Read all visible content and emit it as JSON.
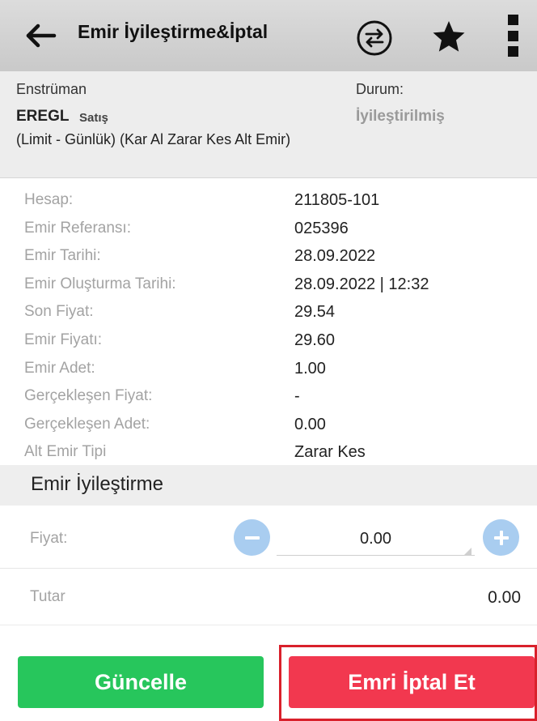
{
  "header": {
    "title": "Emir İyileştirme&İptal",
    "back_icon": "arrow-left-icon",
    "swap_icon": "swap-circle-icon",
    "favorite_icon": "star-icon",
    "more_icon": "more-vertical-icon"
  },
  "summary": {
    "instrument_label": "Enstrüman",
    "instrument_code": "EREGL",
    "side": "Satış",
    "description": "(Limit - Günlük)  (Kar Al Zarar Kes Alt Emir)",
    "status_label": "Durum:",
    "status_value": "İyileştirilmiş"
  },
  "details": [
    {
      "key": "Hesap:",
      "value": "211805-101"
    },
    {
      "key": "Emir Referansı:",
      "value": "025396"
    },
    {
      "key": "Emir Tarihi:",
      "value": "28.09.2022"
    },
    {
      "key": "Emir Oluşturma Tarihi:",
      "value": "28.09.2022 | 12:32"
    },
    {
      "key": "Son Fiyat:",
      "value": "29.54"
    },
    {
      "key": "Emir Fiyatı:",
      "value": "29.60"
    },
    {
      "key": "Emir Adet:",
      "value": "1.00"
    },
    {
      "key": "Gerçekleşen Fiyat:",
      "value": "-"
    },
    {
      "key": "Gerçekleşen Adet:",
      "value": "0.00"
    },
    {
      "key": "Alt Emir Tipi",
      "value": "Zarar Kes"
    }
  ],
  "improve": {
    "section_title": "Emir İyileştirme",
    "price_label": "Fiyat:",
    "price_value": "0.00",
    "total_label": "Tutar",
    "total_value": "0.00"
  },
  "actions": {
    "update_label": "Güncelle",
    "cancel_label": "Emri İptal Et"
  },
  "colors": {
    "update": "#27c65c",
    "cancel": "#f2384f",
    "stepper": "#a9cdf0",
    "highlight": "#d9202b"
  }
}
